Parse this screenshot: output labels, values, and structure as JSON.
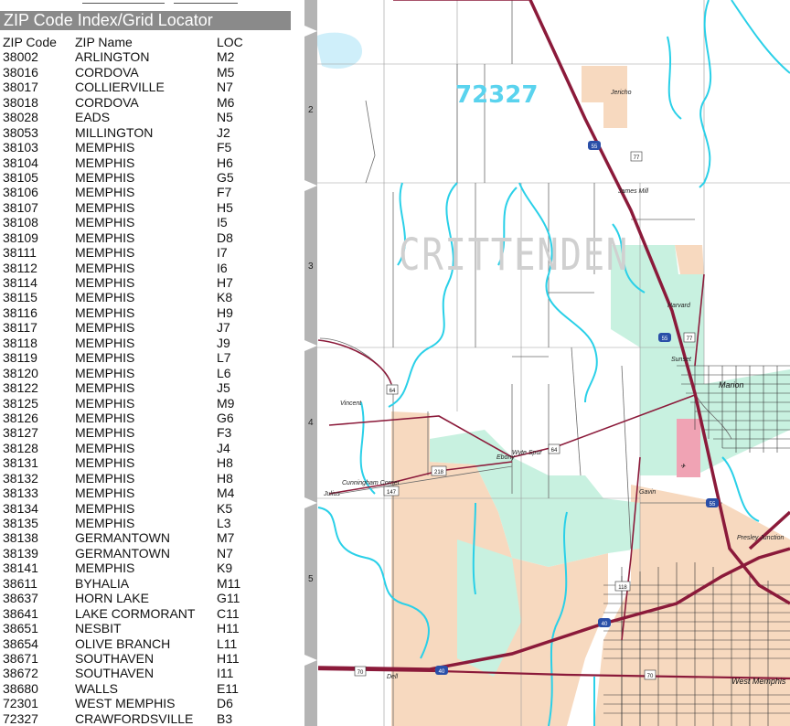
{
  "index": {
    "title": "ZIP Code Index/Grid Locator",
    "headers": [
      "ZIP Code",
      "ZIP Name",
      "LOC"
    ],
    "rows": [
      [
        "38002",
        "ARLINGTON",
        "M2"
      ],
      [
        "38016",
        "CORDOVA",
        "M5"
      ],
      [
        "38017",
        "COLLIERVILLE",
        "N7"
      ],
      [
        "38018",
        "CORDOVA",
        "M6"
      ],
      [
        "38028",
        "EADS",
        "N5"
      ],
      [
        "38053",
        "MILLINGTON",
        "J2"
      ],
      [
        "38103",
        "MEMPHIS",
        "F5"
      ],
      [
        "38104",
        "MEMPHIS",
        "H6"
      ],
      [
        "38105",
        "MEMPHIS",
        "G5"
      ],
      [
        "38106",
        "MEMPHIS",
        "F7"
      ],
      [
        "38107",
        "MEMPHIS",
        "H5"
      ],
      [
        "38108",
        "MEMPHIS",
        "I5"
      ],
      [
        "38109",
        "MEMPHIS",
        "D8"
      ],
      [
        "38111",
        "MEMPHIS",
        "I7"
      ],
      [
        "38112",
        "MEMPHIS",
        "I6"
      ],
      [
        "38114",
        "MEMPHIS",
        "H7"
      ],
      [
        "38115",
        "MEMPHIS",
        "K8"
      ],
      [
        "38116",
        "MEMPHIS",
        "H9"
      ],
      [
        "38117",
        "MEMPHIS",
        "J7"
      ],
      [
        "38118",
        "MEMPHIS",
        "J9"
      ],
      [
        "38119",
        "MEMPHIS",
        "L7"
      ],
      [
        "38120",
        "MEMPHIS",
        "L6"
      ],
      [
        "38122",
        "MEMPHIS",
        "J5"
      ],
      [
        "38125",
        "MEMPHIS",
        "M9"
      ],
      [
        "38126",
        "MEMPHIS",
        "G6"
      ],
      [
        "38127",
        "MEMPHIS",
        "F3"
      ],
      [
        "38128",
        "MEMPHIS",
        "J4"
      ],
      [
        "38131",
        "MEMPHIS",
        "H8"
      ],
      [
        "38132",
        "MEMPHIS",
        "H8"
      ],
      [
        "38133",
        "MEMPHIS",
        "M4"
      ],
      [
        "38134",
        "MEMPHIS",
        "K5"
      ],
      [
        "38135",
        "MEMPHIS",
        "L3"
      ],
      [
        "38138",
        "GERMANTOWN",
        "M7"
      ],
      [
        "38139",
        "GERMANTOWN",
        "N7"
      ],
      [
        "38141",
        "MEMPHIS",
        "K9"
      ],
      [
        "38611",
        "BYHALIA",
        "M11"
      ],
      [
        "38637",
        "HORN LAKE",
        "G11"
      ],
      [
        "38641",
        "LAKE CORMORANT",
        "C11"
      ],
      [
        "38651",
        "NESBIT",
        "H11"
      ],
      [
        "38654",
        "OLIVE BRANCH",
        "L11"
      ],
      [
        "38671",
        "SOUTHAVEN",
        "H11"
      ],
      [
        "38672",
        "SOUTHAVEN",
        "I11"
      ],
      [
        "38680",
        "WALLS",
        "E11"
      ],
      [
        "72301",
        "WEST MEMPHIS",
        "D6"
      ],
      [
        "72327",
        "CRAWFORDSVILLE",
        "B3"
      ]
    ]
  },
  "map": {
    "zip_label": "72327",
    "county_label": "CRITTENDEN",
    "grid_rows": [
      "2",
      "3",
      "4",
      "5"
    ],
    "places": {
      "jericho": "Jericho",
      "james_mill": "James Mill",
      "harvard": "Harvard",
      "sunset": "Sunset",
      "marion": "Marion",
      "vincent": "Vincent",
      "ebony": "Ebony",
      "wyte_spur": "Wyte Spur",
      "cunningham_corner": "Cunningham Corner",
      "julius": "Julius",
      "gavin": "Gavin",
      "presley_junction": "Presley Junction",
      "west_memphis": "West Memphis",
      "dell": "Dell"
    },
    "highway_shields": {
      "i55_north": "55",
      "i55_mid": "55",
      "i55_south": "55",
      "i40_west": "40",
      "i40_mid": "40",
      "us64_west": "64",
      "us64_east": "64",
      "ar77_north": "77",
      "ar77_mid": "77",
      "us70_west": "70",
      "us70_east": "70",
      "ar218": "218",
      "ar147": "147",
      "ar118": "118"
    },
    "colors": {
      "water": "#2ad0e8",
      "interstate": "#8b1a3a",
      "urban": "#f7d9bf",
      "park": "#c8f1e0",
      "airport": "#f0a3b4",
      "frame": "#b4b4b4"
    }
  }
}
